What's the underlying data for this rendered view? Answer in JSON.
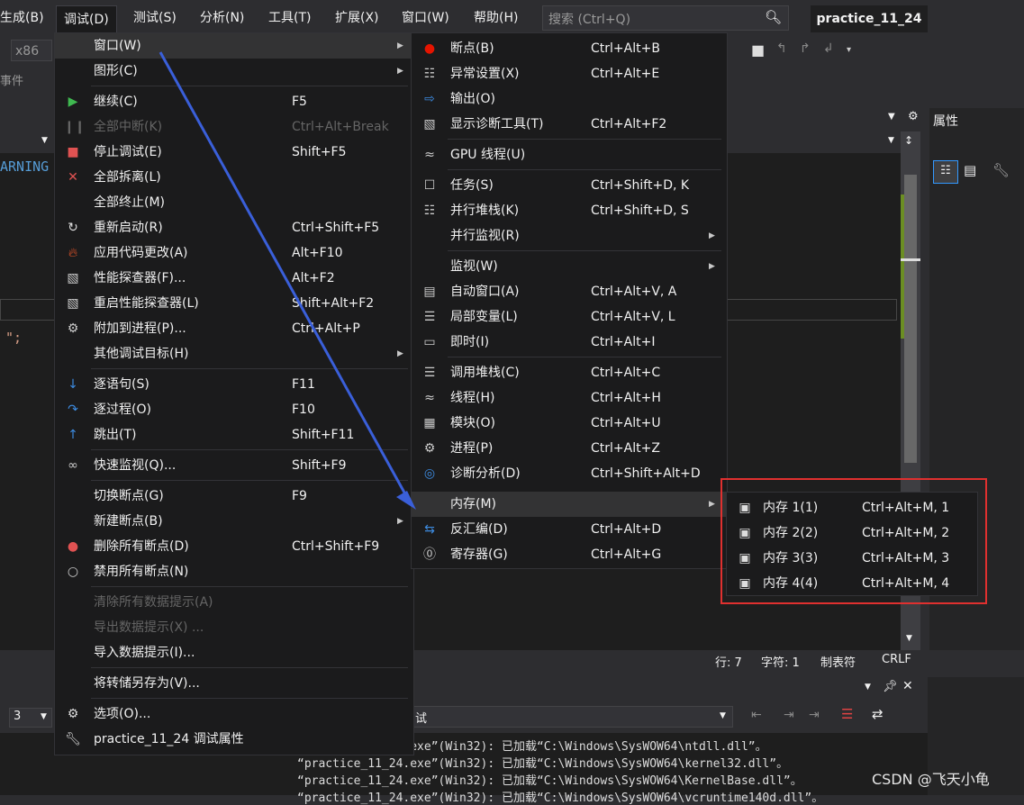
{
  "menubar": {
    "items": [
      "生成(B)",
      "调试(D)",
      "测试(S)",
      "分析(N)",
      "工具(T)",
      "扩展(X)",
      "窗口(W)",
      "帮助(H)"
    ],
    "search_placeholder": "搜索 (Ctrl+Q)",
    "project_name": "practice_11_24"
  },
  "toolbar": {
    "platform": "x86",
    "events_label": "事件",
    "properties_title": "属性"
  },
  "editor": {
    "code_fragment_1": "ARNING",
    "code_fragment_2": "\";"
  },
  "debug_menu": {
    "items": [
      {
        "label": "窗口(W)",
        "shortcut": "",
        "icon": "",
        "submenu": true,
        "disabled": false,
        "highlight": true
      },
      {
        "label": "图形(C)",
        "shortcut": "",
        "icon": "",
        "submenu": true,
        "disabled": false
      },
      {
        "label": "继续(C)",
        "shortcut": "F5",
        "icon": "play-icon",
        "disabled": false
      },
      {
        "label": "全部中断(K)",
        "shortcut": "Ctrl+Alt+Break",
        "icon": "pause-icon",
        "disabled": true
      },
      {
        "label": "停止调试(E)",
        "shortcut": "Shift+F5",
        "icon": "stop-icon",
        "disabled": false
      },
      {
        "label": "全部拆离(L)",
        "shortcut": "",
        "icon": "close-icon",
        "disabled": false
      },
      {
        "label": "全部终止(M)",
        "shortcut": "",
        "icon": "",
        "disabled": false
      },
      {
        "label": "重新启动(R)",
        "shortcut": "Ctrl+Shift+F5",
        "icon": "restart-icon",
        "disabled": false
      },
      {
        "label": "应用代码更改(A)",
        "shortcut": "Alt+F10",
        "icon": "flame-icon",
        "disabled": false
      },
      {
        "label": "性能探查器(F)...",
        "shortcut": "Alt+F2",
        "icon": "profiler-icon",
        "disabled": false
      },
      {
        "label": "重启性能探查器(L)",
        "shortcut": "Shift+Alt+F2",
        "icon": "profiler-icon",
        "disabled": false
      },
      {
        "label": "附加到进程(P)...",
        "shortcut": "Ctrl+Alt+P",
        "icon": "gears-icon",
        "disabled": false
      },
      {
        "label": "其他调试目标(H)",
        "shortcut": "",
        "icon": "",
        "submenu": true,
        "disabled": false
      },
      {
        "label": "逐语句(S)",
        "shortcut": "F11",
        "icon": "step-into-icon",
        "disabled": false
      },
      {
        "label": "逐过程(O)",
        "shortcut": "F10",
        "icon": "step-over-icon",
        "disabled": false
      },
      {
        "label": "跳出(T)",
        "shortcut": "Shift+F11",
        "icon": "step-out-icon",
        "disabled": false
      },
      {
        "label": "快速监视(Q)...",
        "shortcut": "Shift+F9",
        "icon": "glasses-icon",
        "disabled": false
      },
      {
        "label": "切换断点(G)",
        "shortcut": "F9",
        "icon": "",
        "disabled": false
      },
      {
        "label": "新建断点(B)",
        "shortcut": "",
        "icon": "",
        "submenu": true,
        "disabled": false
      },
      {
        "label": "删除所有断点(D)",
        "shortcut": "Ctrl+Shift+F9",
        "icon": "delete-breakpoints-icon",
        "disabled": false
      },
      {
        "label": "禁用所有断点(N)",
        "shortcut": "",
        "icon": "disable-breakpoints-icon",
        "disabled": false
      },
      {
        "label": "清除所有数据提示(A)",
        "shortcut": "",
        "icon": "",
        "disabled": true
      },
      {
        "label": "导出数据提示(X) ...",
        "shortcut": "",
        "icon": "",
        "disabled": true
      },
      {
        "label": "导入数据提示(I)...",
        "shortcut": "",
        "icon": "",
        "disabled": false
      },
      {
        "label": "将转储另存为(V)...",
        "shortcut": "",
        "icon": "",
        "disabled": false
      },
      {
        "label": "选项(O)...",
        "shortcut": "",
        "icon": "gear-icon",
        "disabled": false
      },
      {
        "label": "practice_11_24 调试属性",
        "shortcut": "",
        "icon": "wrench-icon",
        "disabled": false
      }
    ]
  },
  "window_menu": {
    "items": [
      {
        "label": "断点(B)",
        "shortcut": "Ctrl+Alt+B",
        "icon": "breakpoint-icon"
      },
      {
        "label": "异常设置(X)",
        "shortcut": "Ctrl+Alt+E",
        "icon": "exception-icon"
      },
      {
        "label": "输出(O)",
        "shortcut": "",
        "icon": "output-icon"
      },
      {
        "label": "显示诊断工具(T)",
        "shortcut": "Ctrl+Alt+F2",
        "icon": "diagnostics-icon"
      },
      {
        "label": "GPU 线程(U)",
        "shortcut": "",
        "icon": "gpu-threads-icon"
      },
      {
        "label": "任务(S)",
        "shortcut": "Ctrl+Shift+D, K",
        "icon": "tasks-icon"
      },
      {
        "label": "并行堆栈(K)",
        "shortcut": "Ctrl+Shift+D, S",
        "icon": "parallel-stacks-icon"
      },
      {
        "label": "并行监视(R)",
        "shortcut": "",
        "icon": "",
        "submenu": true
      },
      {
        "label": "监视(W)",
        "shortcut": "",
        "icon": "",
        "submenu": true
      },
      {
        "label": "自动窗口(A)",
        "shortcut": "Ctrl+Alt+V, A",
        "icon": "autos-icon"
      },
      {
        "label": "局部变量(L)",
        "shortcut": "Ctrl+Alt+V, L",
        "icon": "locals-icon"
      },
      {
        "label": "即时(I)",
        "shortcut": "Ctrl+Alt+I",
        "icon": "immediate-icon"
      },
      {
        "label": "调用堆栈(C)",
        "shortcut": "Ctrl+Alt+C",
        "icon": "call-stack-icon"
      },
      {
        "label": "线程(H)",
        "shortcut": "Ctrl+Alt+H",
        "icon": "threads-icon"
      },
      {
        "label": "模块(O)",
        "shortcut": "Ctrl+Alt+U",
        "icon": "modules-icon"
      },
      {
        "label": "进程(P)",
        "shortcut": "Ctrl+Alt+Z",
        "icon": "processes-icon"
      },
      {
        "label": "诊断分析(D)",
        "shortcut": "Ctrl+Shift+Alt+D",
        "icon": "diagnostic-analysis-icon"
      },
      {
        "label": "内存(M)",
        "shortcut": "",
        "icon": "",
        "submenu": true,
        "highlight": true
      },
      {
        "label": "反汇编(D)",
        "shortcut": "Ctrl+Alt+D",
        "icon": "disassembly-icon"
      },
      {
        "label": "寄存器(G)",
        "shortcut": "Ctrl+Alt+G",
        "icon": "registers-icon"
      }
    ]
  },
  "memory_menu": {
    "items": [
      {
        "label": "内存 1(1)",
        "shortcut": "Ctrl+Alt+M, 1",
        "icon": "memory-icon"
      },
      {
        "label": "内存 2(2)",
        "shortcut": "Ctrl+Alt+M, 2",
        "icon": "memory-icon"
      },
      {
        "label": "内存 3(3)",
        "shortcut": "Ctrl+Alt+M, 3",
        "icon": "memory-icon"
      },
      {
        "label": "内存 4(4)",
        "shortcut": "Ctrl+Alt+M, 4",
        "icon": "memory-icon"
      }
    ]
  },
  "statusbar": {
    "line": "行: 7",
    "col": "字符: 1",
    "indent": "制表符",
    "eol": "CRLF"
  },
  "output": {
    "source_label": "试",
    "stack_value": "3",
    "lines": [
      "“practice_11_24.exe”(Win32): 已加载“C:\\Windows\\SysWOW64\\ntdll.dll”。",
      "“practice_11_24.exe”(Win32): 已加载“C:\\Windows\\SysWOW64\\kernel32.dll”。",
      "“practice_11_24.exe”(Win32): 已加载“C:\\Windows\\SysWOW64\\KernelBase.dll”。",
      "“practice_11_24.exe”(Win32): 已加载“C:\\Windows\\SysWOW64\\vcruntime140d.dll”。"
    ]
  },
  "watermark": "CSDN @飞天小龟",
  "colors": {
    "accent_arrow": "#3a5fd9",
    "highlight_box": "#e0302f",
    "menu_bg": "#1b1b1c"
  }
}
